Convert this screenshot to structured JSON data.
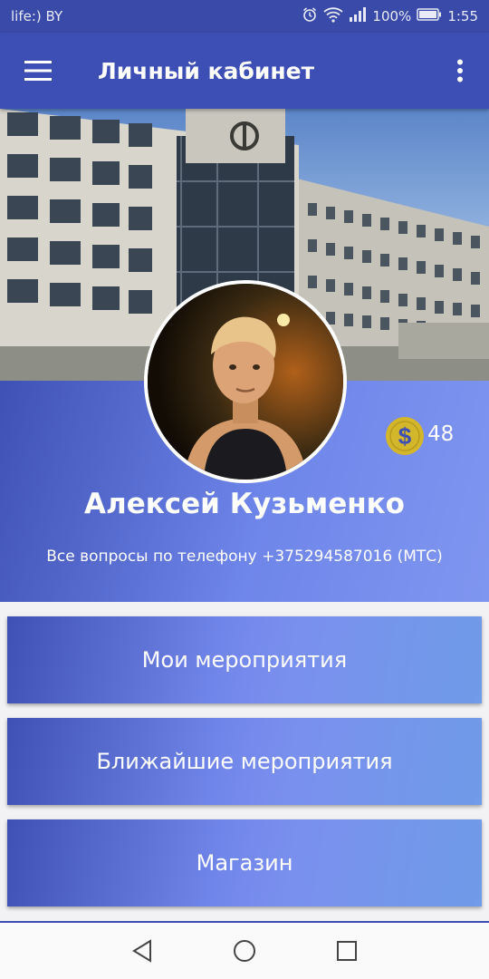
{
  "status_bar": {
    "carrier": "life:) BY",
    "battery": "100%",
    "time": "1:55",
    "icons": [
      "alarm-icon",
      "wifi-icon",
      "signal-icon",
      "battery-icon"
    ]
  },
  "app_bar": {
    "title": "Личный кабинет",
    "icons": [
      "hamburger-menu-icon",
      "more-vert-icon"
    ],
    "color": "#3d4fb4"
  },
  "profile": {
    "coin_icon": "dollar-coin-icon",
    "coins": "48",
    "name": "Алексей Кузьменко",
    "contact_text": "Все вопросы по телефону +375294587016 (МТС)"
  },
  "menu": {
    "items": [
      {
        "label": "Мои мероприятия"
      },
      {
        "label": "Ближайшие мероприятия"
      },
      {
        "label": "Магазин"
      }
    ]
  },
  "nav_bar": {
    "icons": [
      "back-icon",
      "home-icon",
      "recents-icon"
    ]
  },
  "colors": {
    "primary": "#3f51b5",
    "accent_light": "#7f96f0",
    "coin": "#d3b62a"
  }
}
